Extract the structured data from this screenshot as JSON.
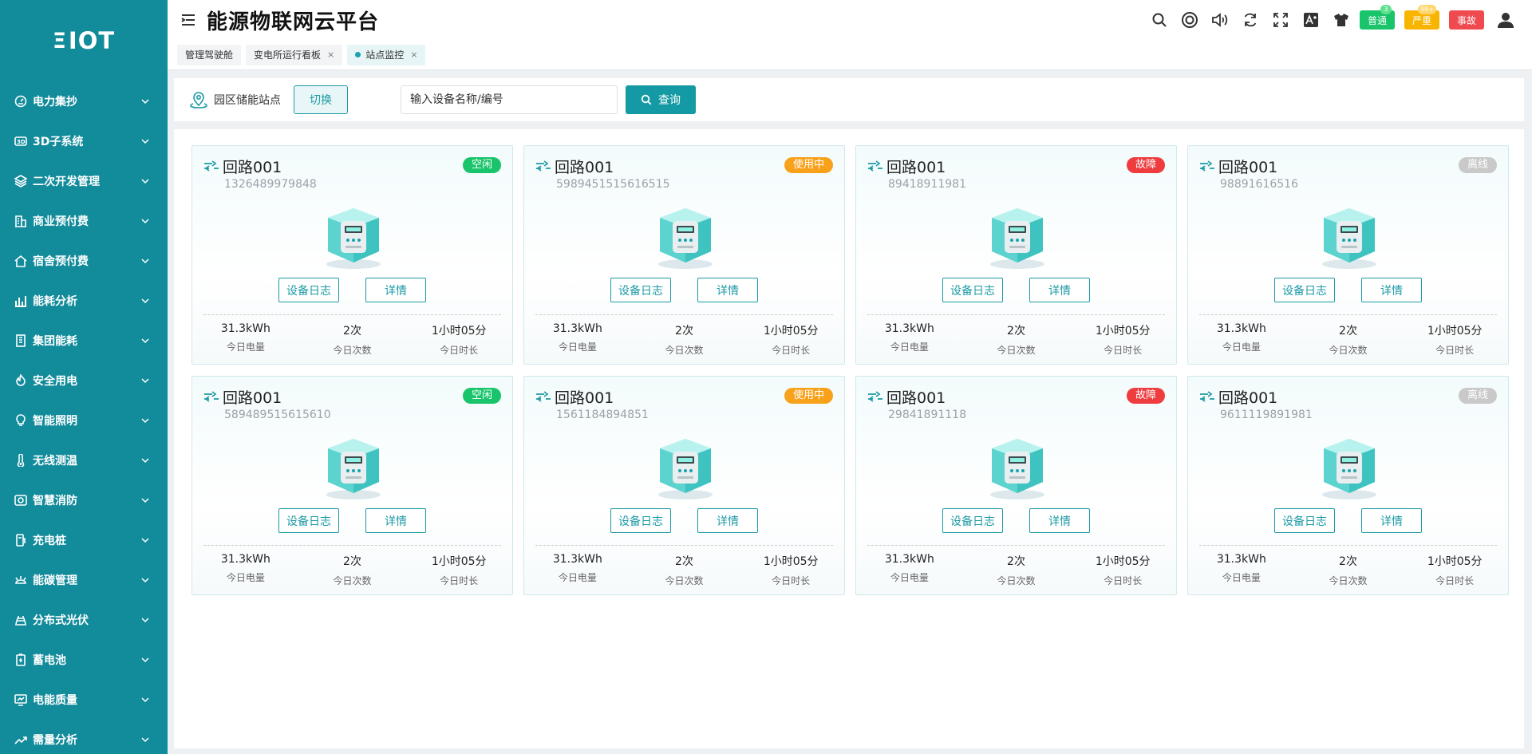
{
  "app": {
    "logo": "IOT",
    "logo_mark": "Ξ",
    "title": "能源物联网云平台"
  },
  "colors": {
    "sidebar": "#128b9b",
    "accent": "#139aa4",
    "idle": "#19c46b",
    "in_use": "#f8a21c",
    "fault": "#ee3c3f",
    "offline": "#c9c9c9"
  },
  "sidebar": {
    "items": [
      {
        "label": "电力集抄",
        "icon": "meter-gauge-icon"
      },
      {
        "label": "3D子系统",
        "icon": "3d-cube-icon"
      },
      {
        "label": "二次开发管理",
        "icon": "layers-icon"
      },
      {
        "label": "商业预付费",
        "icon": "building-icon"
      },
      {
        "label": "宿舍预付费",
        "icon": "home-icon"
      },
      {
        "label": "能耗分析",
        "icon": "bar-chart-icon"
      },
      {
        "label": "集团能耗",
        "icon": "office-building-icon"
      },
      {
        "label": "安全用电",
        "icon": "flame-icon"
      },
      {
        "label": "智能照明",
        "icon": "bulb-icon"
      },
      {
        "label": "无线测温",
        "icon": "thermometer-icon"
      },
      {
        "label": "智慧消防",
        "icon": "fire-alarm-icon"
      },
      {
        "label": "充电桩",
        "icon": "charger-icon"
      },
      {
        "label": "能碳管理",
        "icon": "carbon-icon"
      },
      {
        "label": "分布式光伏",
        "icon": "solar-panel-icon"
      },
      {
        "label": "蓄电池",
        "icon": "battery-icon"
      },
      {
        "label": "电能质量",
        "icon": "monitor-icon"
      },
      {
        "label": "需量分析",
        "icon": "trend-icon"
      }
    ]
  },
  "header": {
    "icons": [
      "search-icon",
      "help-ring-icon",
      "volume-icon",
      "refresh-icon",
      "fullscreen-icon",
      "font-size-icon",
      "theme-shirt-icon"
    ],
    "badges": [
      {
        "label": "普通",
        "count": "3"
      },
      {
        "label": "严重",
        "count": "99+"
      },
      {
        "label": "事故"
      }
    ],
    "user_icon": "user-icon"
  },
  "tabs": [
    {
      "label": "管理驾驶舱",
      "closable": false,
      "active": false
    },
    {
      "label": "变电所运行看板",
      "closable": true,
      "active": false
    },
    {
      "label": "站点监控",
      "closable": true,
      "active": true
    }
  ],
  "toolbar": {
    "site_label": "园区储能站点",
    "switch_label": "切换",
    "search_placeholder": "输入设备名称/编号",
    "query_label": "查询"
  },
  "card_labels": {
    "log_button": "设备日志",
    "detail_button": "详情",
    "stat_energy": "今日电量",
    "stat_count": "今日次数",
    "stat_duration": "今日时长"
  },
  "cards": [
    {
      "title": "回路001",
      "sn": "1326489979848",
      "status": "空闲",
      "status_key": "idle",
      "energy": "31.3kWh",
      "count": "2次",
      "duration": "1小时05分"
    },
    {
      "title": "回路001",
      "sn": "5989451515616515",
      "status": "使用中",
      "status_key": "use",
      "energy": "31.3kWh",
      "count": "2次",
      "duration": "1小时05分"
    },
    {
      "title": "回路001",
      "sn": "89418911981",
      "status": "故障",
      "status_key": "fault",
      "energy": "31.3kWh",
      "count": "2次",
      "duration": "1小时05分"
    },
    {
      "title": "回路001",
      "sn": "98891616516",
      "status": "离线",
      "status_key": "off",
      "energy": "31.3kWh",
      "count": "2次",
      "duration": "1小时05分"
    },
    {
      "title": "回路001",
      "sn": "589489515615610",
      "status": "空闲",
      "status_key": "idle",
      "energy": "31.3kWh",
      "count": "2次",
      "duration": "1小时05分"
    },
    {
      "title": "回路001",
      "sn": "1561184894851",
      "status": "使用中",
      "status_key": "use",
      "energy": "31.3kWh",
      "count": "2次",
      "duration": "1小时05分"
    },
    {
      "title": "回路001",
      "sn": "29841891118",
      "status": "故障",
      "status_key": "fault",
      "energy": "31.3kWh",
      "count": "2次",
      "duration": "1小时05分"
    },
    {
      "title": "回路001",
      "sn": "9611119891981",
      "status": "离线",
      "status_key": "off",
      "energy": "31.3kWh",
      "count": "2次",
      "duration": "1小时05分"
    }
  ]
}
